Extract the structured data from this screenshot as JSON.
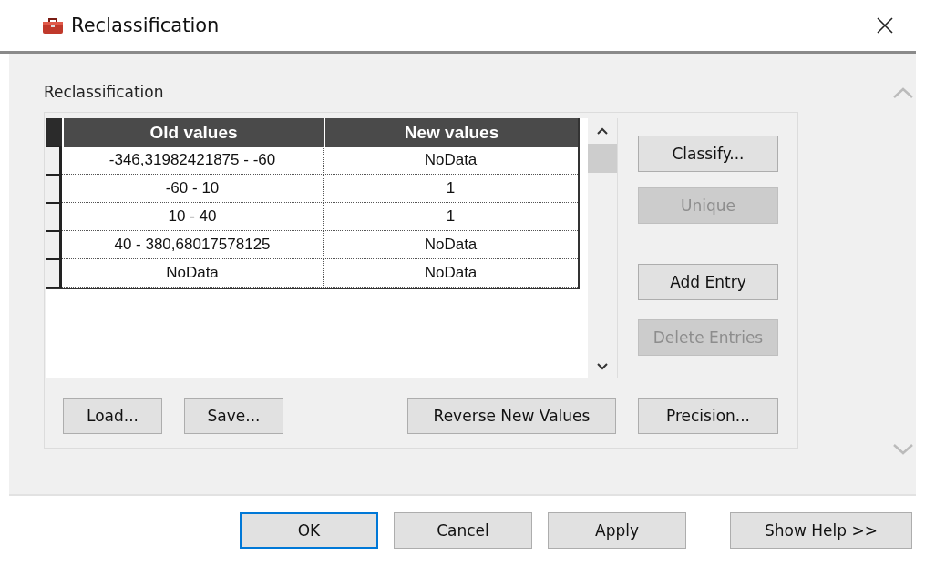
{
  "window": {
    "title": "Reclassification"
  },
  "section_label": "Reclassification",
  "table": {
    "columns": [
      "Old values",
      "New values"
    ],
    "rows": [
      {
        "old": "-346,31982421875 - -60",
        "new": "NoData"
      },
      {
        "old": "-60 - 10",
        "new": "1"
      },
      {
        "old": "10 - 40",
        "new": "1"
      },
      {
        "old": "40 - 380,68017578125",
        "new": "NoData"
      },
      {
        "old": "NoData",
        "new": "NoData"
      }
    ]
  },
  "side_buttons": [
    {
      "label": "Classify...",
      "disabled": false
    },
    {
      "label": "Unique",
      "disabled": true
    },
    {
      "label": "Add Entry",
      "disabled": false
    },
    {
      "label": "Delete Entries",
      "disabled": true
    }
  ],
  "table_buttons": [
    {
      "label": "Load...",
      "disabled": false
    },
    {
      "label": "Save...",
      "disabled": false
    },
    {
      "label": "Reverse New Values",
      "disabled": false
    },
    {
      "label": "Precision...",
      "disabled": false
    }
  ],
  "dialog_buttons": [
    {
      "label": "OK",
      "default": true
    },
    {
      "label": "Cancel",
      "default": false
    },
    {
      "label": "Apply",
      "default": false
    },
    {
      "label": "Show Help >>",
      "default": false
    }
  ]
}
